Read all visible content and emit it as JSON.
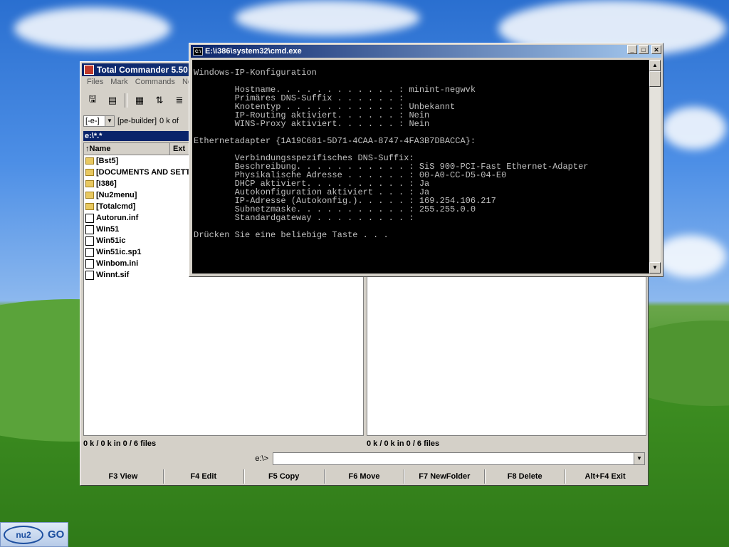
{
  "total_commander": {
    "title": "Total Commander 5.50",
    "menu": [
      "Files",
      "Mark",
      "Commands",
      "Ne"
    ],
    "drive_select": "[-e-]",
    "drive_label": "[pe-builder]",
    "drive_free": "0 k of",
    "path": "e:\\*.*",
    "columns": {
      "name": "↑Name",
      "ext": "Ext"
    },
    "files": [
      {
        "name": "[Bst5]",
        "type": "folder"
      },
      {
        "name": "[DOCUMENTS AND SETTI",
        "type": "folder"
      },
      {
        "name": "[I386]",
        "type": "folder"
      },
      {
        "name": "[Nu2menu]",
        "type": "folder"
      },
      {
        "name": "[Totalcmd]",
        "type": "folder"
      },
      {
        "name": "Autorun.inf",
        "type": "file"
      },
      {
        "name": "Win51",
        "type": "file"
      },
      {
        "name": "Win51ic",
        "type": "file"
      },
      {
        "name": "Win51ic.sp1",
        "type": "file"
      },
      {
        "name": "Winbom.ini",
        "type": "file"
      },
      {
        "name": "Winnt.sif",
        "type": "file"
      }
    ],
    "status_left": "0 k / 0 k in 0 / 6 files",
    "status_right": "0 k / 0 k in 0 / 6 files",
    "cmdline_label": "e:\\>",
    "fkeys": [
      "F3 View",
      "F4 Edit",
      "F5 Copy",
      "F6 Move",
      "F7 NewFolder",
      "F8 Delete",
      "Alt+F4 Exit"
    ]
  },
  "cmd_window": {
    "title": "E:\\i386\\system32\\cmd.exe",
    "icon_text": "C:\\",
    "output": "\nWindows-IP-Konfiguration\n\n        Hostname. . . . . . . . . . . . : minint-negwvk\n        Primäres DNS-Suffix . . . . . . : \n        Knotentyp . . . . . . . . . . . : Unbekannt\n        IP-Routing aktiviert. . . . . . : Nein\n        WINS-Proxy aktiviert. . . . . . : Nein\n\nEthernetadapter {1A19C681-5D71-4CAA-8747-4FA3B7DBACCA}:\n\n        Verbindungsspezifisches DNS-Suffix: \n        Beschreibung. . . . . . . . . . . : SiS 900-PCI-Fast Ethernet-Adapter\n        Physikalische Adresse . . . . . . : 00-A0-CC-D5-04-E0\n        DHCP aktiviert. . . . . . . . . . : Ja\n        Autokonfiguration aktiviert . . . : Ja\n        IP-Adresse (Autokonfig.). . . . . : 169.254.106.217\n        Subnetzmaske. . . . . . . . . . . : 255.255.0.0\n        Standardgateway . . . . . . . . . : \n\nDrücken Sie eine beliebige Taste . . ."
  },
  "start_button": {
    "logo": "nu2",
    "label": "GO"
  }
}
